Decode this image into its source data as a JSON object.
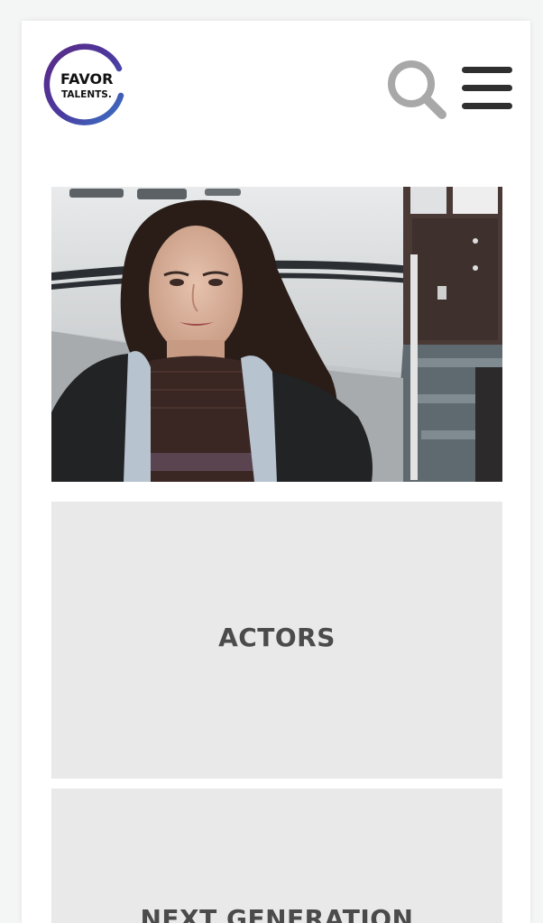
{
  "brand": {
    "logo_line1": "FAVOR",
    "logo_line2": "TALENTS.",
    "gradient_start": "#5b2a86",
    "gradient_end": "#3a73c4"
  },
  "header": {
    "search_icon": "search-icon",
    "menu_icon": "hamburger-menu-icon",
    "icon_color_search": "#a8a8a8",
    "icon_color_menu": "#2f2f2f"
  },
  "tiles": [
    {
      "label": "ACTORS"
    },
    {
      "label": "NEXT GENERATION"
    }
  ],
  "colors": {
    "tile_background": "#e9e9e9",
    "tile_text": "#4b4b4b"
  }
}
